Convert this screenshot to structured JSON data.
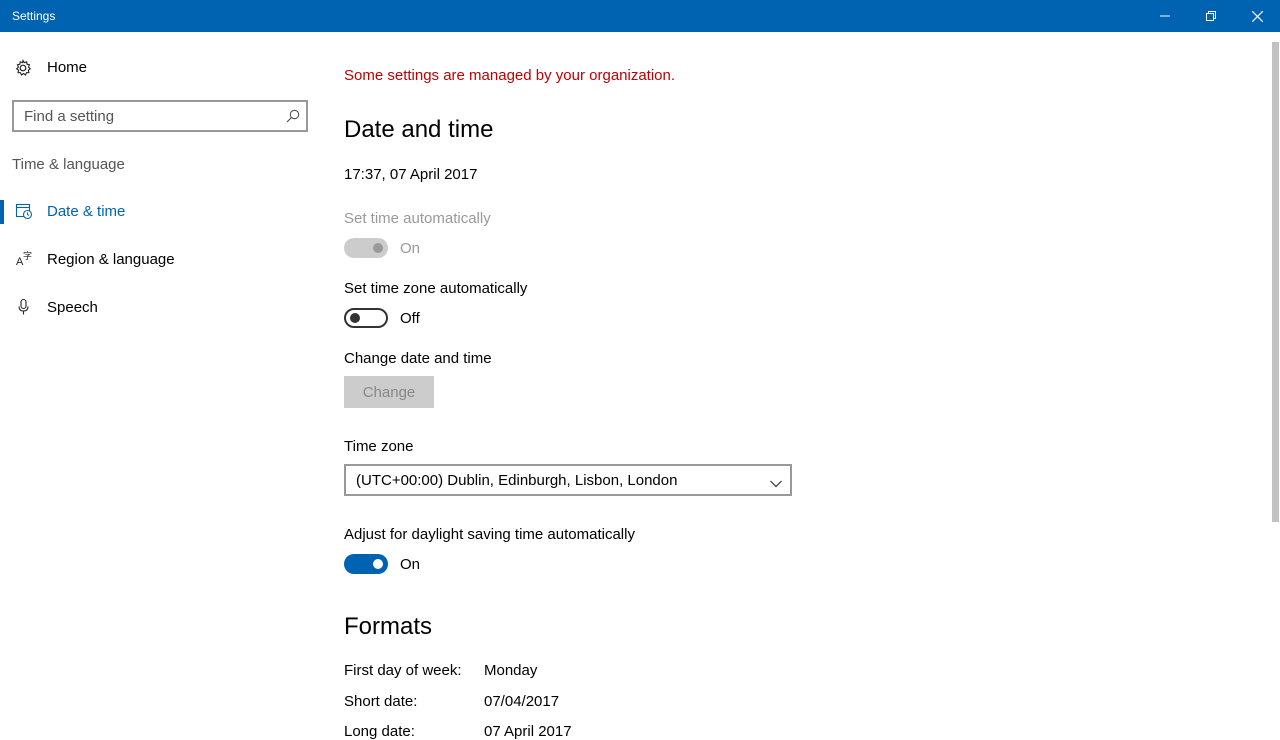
{
  "window": {
    "title": "Settings",
    "controls": {
      "minimize": "minimize-icon",
      "restore": "restore-icon",
      "close": "close-icon"
    }
  },
  "sidebar": {
    "home_label": "Home",
    "search_placeholder": "Find a setting",
    "section_label": "Time & language",
    "items": [
      {
        "label": "Date & time",
        "icon": "calendar-clock-icon",
        "active": true
      },
      {
        "label": "Region & language",
        "icon": "region-language-icon",
        "active": false
      },
      {
        "label": "Speech",
        "icon": "microphone-icon",
        "active": false
      }
    ]
  },
  "main": {
    "org_message": "Some settings are managed by your organization.",
    "heading": "Date and time",
    "current_datetime": "17:37, 07 April 2017",
    "set_time_auto": {
      "label": "Set time automatically",
      "state": "On",
      "enabled": false
    },
    "set_timezone_auto": {
      "label": "Set time zone automatically",
      "state": "Off"
    },
    "change_date_time": {
      "label": "Change date and time",
      "button": "Change"
    },
    "time_zone": {
      "label": "Time zone",
      "value": "(UTC+00:00) Dublin, Edinburgh, Lisbon, London"
    },
    "daylight_saving": {
      "label": "Adjust for daylight saving time automatically",
      "state": "On"
    },
    "formats": {
      "heading": "Formats",
      "rows": [
        {
          "label": "First day of week:",
          "value": "Monday"
        },
        {
          "label": "Short date:",
          "value": "07/04/2017"
        },
        {
          "label": "Long date:",
          "value": "07 April 2017"
        }
      ]
    }
  },
  "colors": {
    "accent": "#0063b1",
    "warning": "#c00000"
  }
}
